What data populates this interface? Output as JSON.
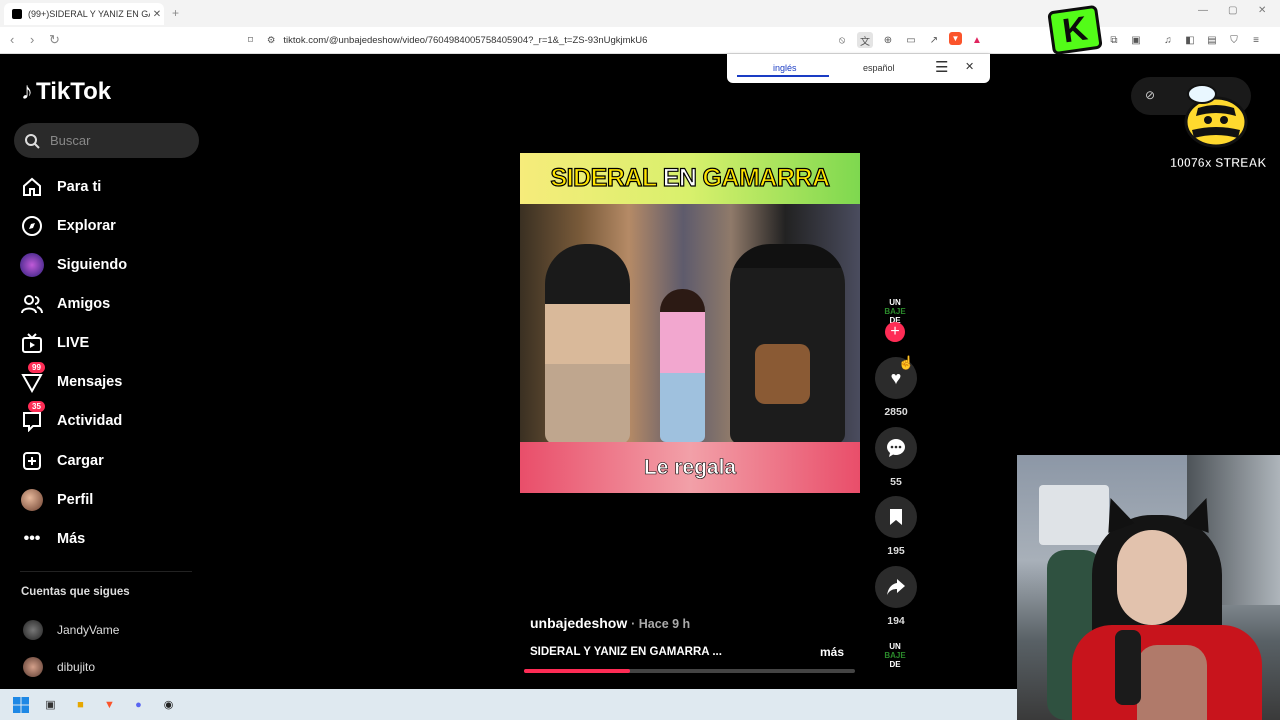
{
  "browser": {
    "tab_title": "(99+)SIDERAL Y YANIZ EN GA",
    "tab_close": "✕",
    "new_tab": "+",
    "url": "tiktok.com/@unbajedeshow/video/7604984005758405904?_r=1&_t=ZS-93nUgkjmkU6",
    "window_controls": [
      "—",
      "▢",
      "✕"
    ]
  },
  "translate": {
    "lang_from": "inglés",
    "lang_to": "español"
  },
  "sidebar": {
    "logo": "TikTok",
    "search_placeholder": "Buscar",
    "items": [
      {
        "label": "Para ti",
        "icon": "home-icon"
      },
      {
        "label": "Explorar",
        "icon": "compass-icon"
      },
      {
        "label": "Siguiendo",
        "icon": "following-avatar-icon"
      },
      {
        "label": "Amigos",
        "icon": "friends-icon"
      },
      {
        "label": "LIVE",
        "icon": "live-tv-icon"
      },
      {
        "label": "Mensajes",
        "icon": "send-icon",
        "badge": "99"
      },
      {
        "label": "Actividad",
        "icon": "activity-icon",
        "badge": "35"
      },
      {
        "label": "Cargar",
        "icon": "upload-icon"
      },
      {
        "label": "Perfil",
        "icon": "profile-avatar-icon"
      },
      {
        "label": "Más",
        "icon": "more-icon"
      }
    ],
    "following_header": "Cuentas que sigues",
    "following": [
      {
        "name": "JandyVame"
      },
      {
        "name": "dibujito"
      }
    ]
  },
  "video": {
    "title_word1": "SIDERAL",
    "title_word2": "EN",
    "title_word3": "GAMARRA",
    "caption": "Le regala",
    "author": "unbajedeshow",
    "posted": "· Hace 9 h",
    "description": "SIDERAL Y YANIZ EN GAMARRA ...",
    "more": "más",
    "progress": 0.32
  },
  "actions": {
    "channel_line1": "UN",
    "channel_line2": "BAJE",
    "channel_line3": "DE",
    "likes": "2850",
    "comments": "55",
    "saves": "195",
    "shares": "194"
  },
  "overlay": {
    "streak": "10076x STREAK",
    "kick_letter": "K"
  },
  "colors": {
    "accent": "#fe2c55",
    "kick": "#53fc18"
  }
}
